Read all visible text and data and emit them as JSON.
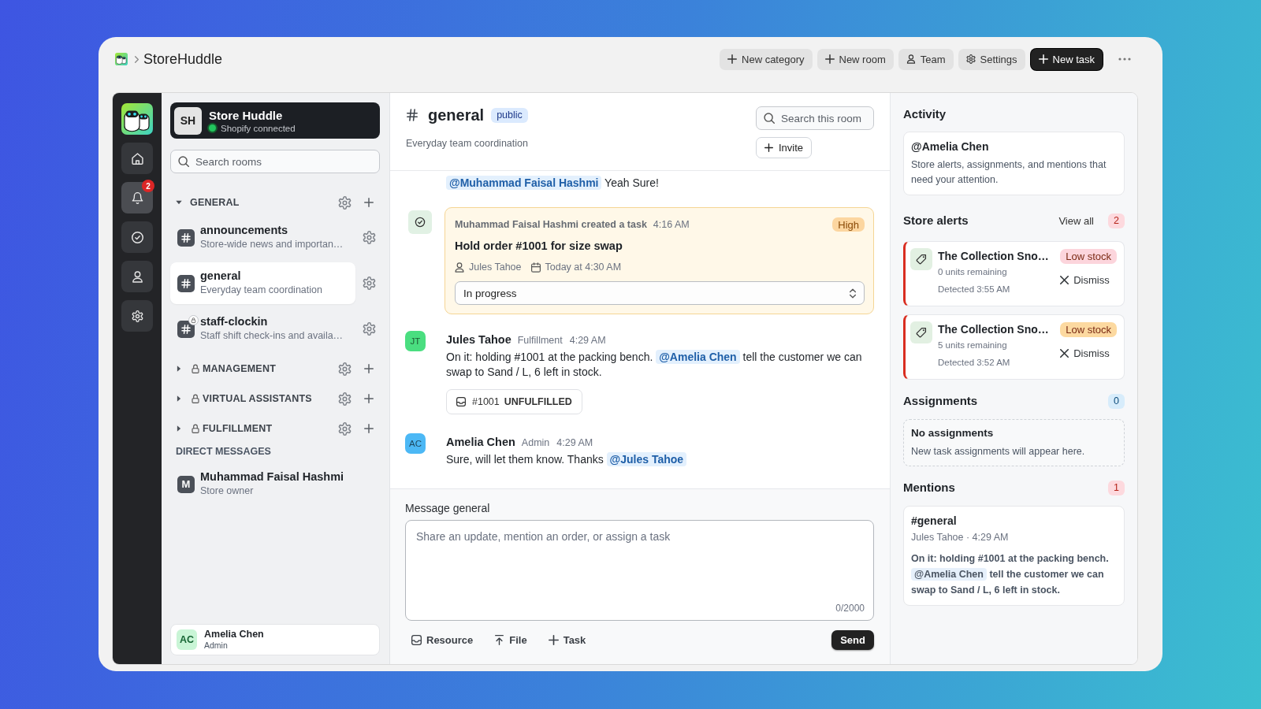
{
  "app": {
    "title": "StoreHuddle"
  },
  "toolbar": {
    "buttons": [
      {
        "kind": "add",
        "label": "New category",
        "primary": false
      },
      {
        "kind": "add",
        "label": "New room",
        "primary": false
      },
      {
        "kind": "team",
        "label": "Team",
        "primary": false
      },
      {
        "kind": "settings",
        "label": "Settings",
        "primary": false
      },
      {
        "kind": "add",
        "label": "New task",
        "primary": true
      }
    ]
  },
  "rail": {
    "items": [
      {
        "kind": "home",
        "selected": false
      },
      {
        "kind": "bell",
        "selected": true,
        "badge": "2"
      },
      {
        "kind": "tasks",
        "selected": false
      },
      {
        "kind": "profile",
        "selected": false
      },
      {
        "kind": "settings",
        "selected": false
      }
    ]
  },
  "workspace": {
    "initials": "SH",
    "name": "Store Huddle",
    "status": "Shopify connected",
    "connected": true
  },
  "room_search": {
    "placeholder": "Search rooms"
  },
  "categories": [
    {
      "label": "GENERAL",
      "expanded": true,
      "locked": false,
      "rooms": [
        {
          "name": "announcements",
          "description": "Store-wide news and importan…",
          "selected": false,
          "locked": false
        },
        {
          "name": "general",
          "description": "Everyday team coordination",
          "selected": true,
          "locked": false
        },
        {
          "name": "staff-clockin",
          "description": "Staff shift check-ins and availa…",
          "selected": false,
          "locked": true
        }
      ]
    },
    {
      "label": "MANAGEMENT",
      "expanded": false,
      "locked": true
    },
    {
      "label": "VIRTUAL ASSISTANTS",
      "expanded": false,
      "locked": true
    },
    {
      "label": "FULFILLMENT",
      "expanded": false,
      "locked": true
    }
  ],
  "direct_messages": {
    "heading": "DIRECT MESSAGES",
    "items": [
      {
        "initial": "M",
        "name": "Muhammad Faisal Hashmi",
        "role": "Store owner"
      }
    ]
  },
  "current_user": {
    "initials": "AC",
    "name": "Amelia Chen",
    "role": "Admin"
  },
  "room": {
    "name": "general",
    "visibility": "public",
    "description": "Everyday team coordination",
    "search": {
      "placeholder": "Search this room"
    },
    "invite": "Invite"
  },
  "messages": [
    {
      "kind": "continuation",
      "segments": [
        {
          "kind": "mention",
          "text": "@Muhammad Faisal Hashmi"
        },
        {
          "kind": "text",
          "text": " Yeah Sure!"
        }
      ]
    },
    {
      "kind": "task",
      "author": "Muhammad Faisal Hashmi created a task",
      "time": "4:16 AM",
      "priority": "High",
      "title": "Hold order #1001 for size swap",
      "assignee": "Jules Tahoe",
      "due": "Today at 4:30 AM",
      "status": "In progress"
    },
    {
      "kind": "message",
      "initials": "JT",
      "color": "#4ade80",
      "name": "Jules Tahoe",
      "role": "Fulfillment",
      "time": "4:29 AM",
      "segments": [
        {
          "kind": "text",
          "text": "On it: holding #1001 at the packing bench. "
        },
        {
          "kind": "mention",
          "text": "@Amelia Chen"
        },
        {
          "kind": "text",
          "text": " tell the customer we can swap to Sand / L, 6 left in stock."
        }
      ],
      "attachment": {
        "order": "#1001",
        "status": "UNFULFILLED"
      }
    },
    {
      "kind": "message",
      "initials": "AC",
      "color": "#4cb8f5",
      "name": "Amelia Chen",
      "role": "Admin",
      "time": "4:29 AM",
      "segments": [
        {
          "kind": "text",
          "text": "Sure, will let them know. Thanks "
        },
        {
          "kind": "mention",
          "text": "@Jules Tahoe"
        }
      ]
    }
  ],
  "composer": {
    "label": "Message general",
    "placeholder": "Share an update, mention an order, or assign a task",
    "counter": "0/2000",
    "actions": [
      {
        "kind": "resource",
        "label": "Resource"
      },
      {
        "kind": "file",
        "label": "File"
      },
      {
        "kind": "task",
        "label": "Task"
      }
    ],
    "send": "Send"
  },
  "activity": {
    "title": "Activity",
    "intro": {
      "handle": "@Amelia Chen",
      "text": "Store alerts, assignments, and mentions that need your attention."
    },
    "store_alerts": {
      "title": "Store alerts",
      "view_all": "View all",
      "count": "2",
      "items": [
        {
          "product": "The Collection Sno…",
          "stock": "0 units remaining",
          "detected": "Detected 3:55 AM",
          "tag": "Low stock",
          "color": "#fcd5dc",
          "dismiss": "Dismiss"
        },
        {
          "product": "The Collection Sno…",
          "stock": "5 units remaining",
          "detected": "Detected 3:52 AM",
          "tag": "Low stock",
          "color": "#fcd9a0",
          "dismiss": "Dismiss"
        }
      ]
    },
    "assignments": {
      "title": "Assignments",
      "count": "0",
      "empty_title": "No assignments",
      "empty_text": "New task assignments will appear here."
    },
    "mentions": {
      "title": "Mentions",
      "count": "1",
      "items": [
        {
          "room": "#general",
          "meta": "Jules Tahoe · 4:29 AM",
          "segments": [
            {
              "kind": "text",
              "text": "On it: holding #1001 at the packing bench. "
            },
            {
              "kind": "mention",
              "text": "@Amelia Chen"
            },
            {
              "kind": "text",
              "text": " tell the customer we can swap to Sand / L, 6 left in stock."
            }
          ]
        }
      ]
    }
  }
}
